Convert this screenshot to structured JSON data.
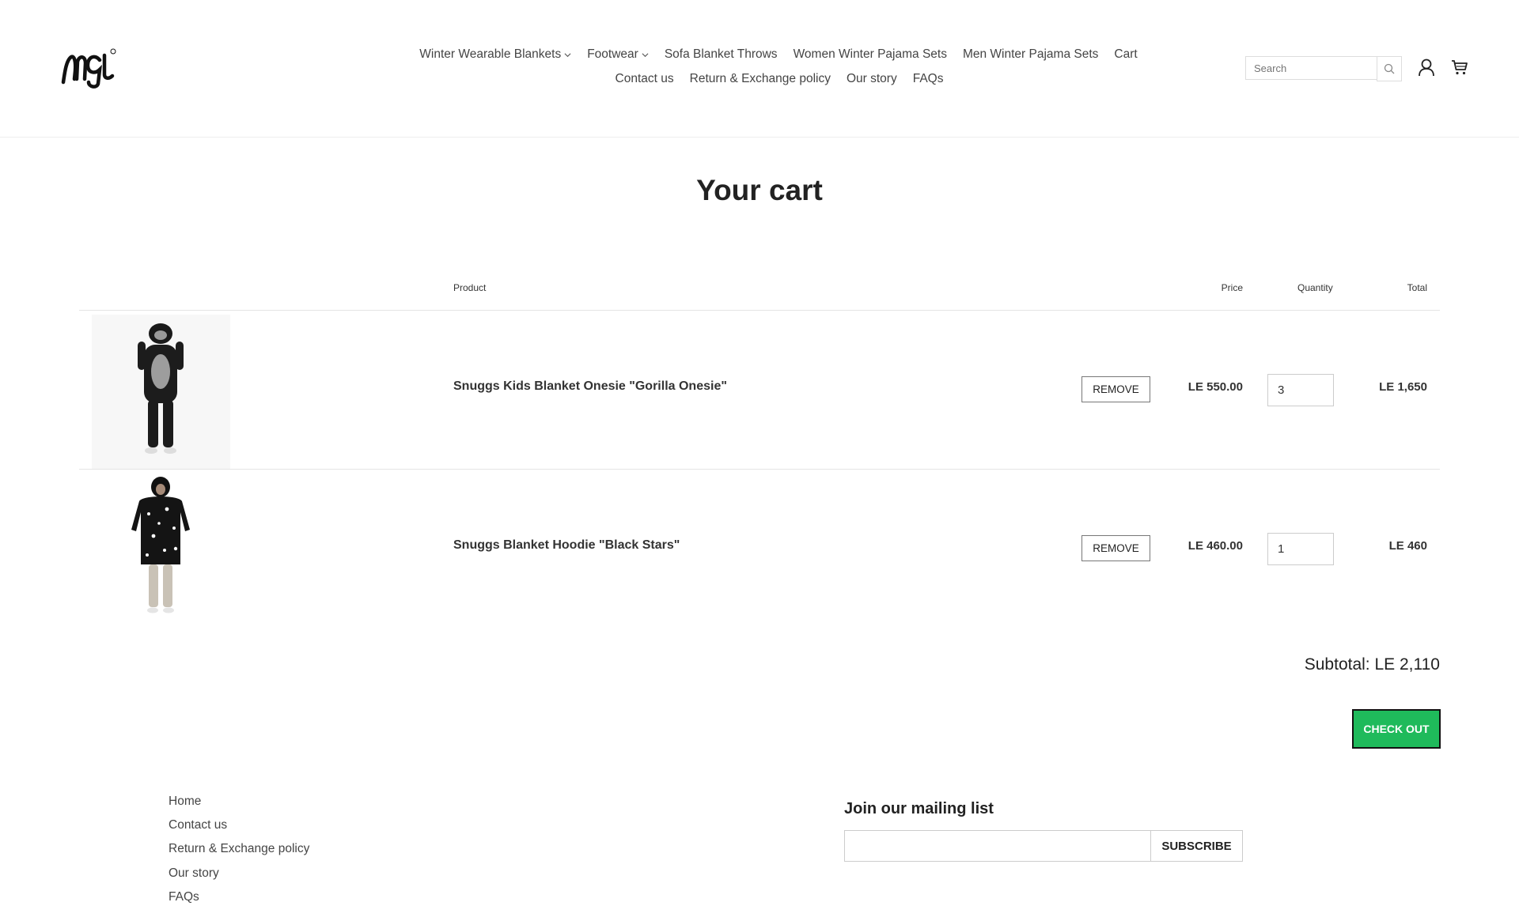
{
  "header": {
    "nav_row1": [
      {
        "label": "Winter Wearable Blankets",
        "has_dropdown": true
      },
      {
        "label": "Footwear",
        "has_dropdown": true
      },
      {
        "label": "Sofa Blanket Throws",
        "has_dropdown": false
      },
      {
        "label": "Women Winter Pajama Sets",
        "has_dropdown": false
      },
      {
        "label": "Men Winter Pajama Sets",
        "has_dropdown": false
      },
      {
        "label": "Cart",
        "has_dropdown": false
      }
    ],
    "nav_row2": [
      {
        "label": "Contact us"
      },
      {
        "label": "Return & Exchange policy"
      },
      {
        "label": "Our story"
      },
      {
        "label": "FAQs"
      }
    ],
    "search_placeholder": "Search",
    "icons": {
      "search": "search-icon",
      "account": "user-icon",
      "cart": "cart-icon"
    }
  },
  "cart": {
    "title": "Your cart",
    "columns": {
      "product": "Product",
      "price": "Price",
      "quantity": "Quantity",
      "total": "Total"
    },
    "items": [
      {
        "name": "Snuggs Kids Blanket Onesie \"Gorilla Onesie\"",
        "remove_label": "REMOVE",
        "price": "LE 550.00",
        "quantity": "3",
        "total": "LE 1,650"
      },
      {
        "name": "Snuggs Blanket Hoodie \"Black Stars\"",
        "remove_label": "REMOVE",
        "price": "LE 460.00",
        "quantity": "1",
        "total": "LE 460"
      }
    ],
    "subtotal": "Subtotal: LE 2,110",
    "checkout_label": "CHECK OUT"
  },
  "footer": {
    "links": [
      "Home",
      "Contact us",
      "Return & Exchange policy",
      "Our story",
      "FAQs"
    ],
    "mailing_title": "Join our mailing list",
    "subscribe_label": "SUBSCRIBE"
  },
  "colors": {
    "checkout_bg": "#1fba5b",
    "text": "#333333"
  }
}
